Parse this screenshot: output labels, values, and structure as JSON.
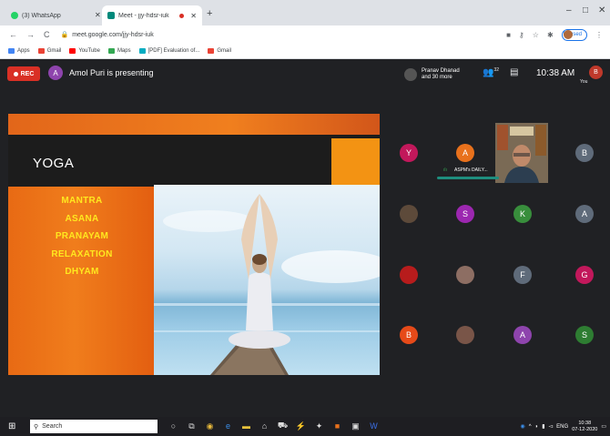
{
  "browser": {
    "tabs": [
      {
        "label": "(3) WhatsApp",
        "icon": "whatsapp-icon",
        "color": "#25d366"
      },
      {
        "label": "Meet - jjy-hdsr-iuk",
        "icon": "meet-icon",
        "color": "#00897b"
      }
    ],
    "new_tab": "+",
    "url": "meet.google.com/jjy-hdsr-iuk",
    "profile_label": "Paused",
    "bookmarks": [
      {
        "label": "Apps",
        "color": "#4285f4"
      },
      {
        "label": "Gmail",
        "color": "#ea4335"
      },
      {
        "label": "YouTube",
        "color": "#ff0000"
      },
      {
        "label": "Maps",
        "color": "#34a853"
      },
      {
        "label": "[PDF] Evaluation of...",
        "color": "#00acc1"
      },
      {
        "label": "Gmail",
        "color": "#ea4335"
      }
    ]
  },
  "meet": {
    "rec_label": "REC",
    "presenter_initial": "A",
    "presenter_text": "Amol Puri is presenting",
    "participants_summary_line1": "Pranav Dhanad",
    "participants_summary_line2": "and 30 more",
    "participants_count": "32",
    "clock": "10:38 AM",
    "you_initial": "B",
    "you_label": "You",
    "active_video_label": "ASPM's DAILY...",
    "slide": {
      "title": "YOGA",
      "items": [
        "MANTRA",
        "ASANA",
        "PRANAYAM",
        "RELAXATION",
        "DHYAM"
      ]
    },
    "participants": [
      {
        "initial": "Y",
        "color": "#c2185b"
      },
      {
        "initial": "A",
        "color": "#e8711c"
      },
      {
        "initial": "B",
        "color": "#5f6b7a"
      },
      {
        "initial": "",
        "color": "#5d4a3a",
        "photo": true
      },
      {
        "initial": "S",
        "color": "#9c27b0"
      },
      {
        "initial": "K",
        "color": "#388e3c"
      },
      {
        "initial": "A",
        "color": "#5f6b7a"
      },
      {
        "initial": "",
        "color": "#b71c1c",
        "photo": true
      },
      {
        "initial": "",
        "color": "#8d6e63",
        "photo": true
      },
      {
        "initial": "F",
        "color": "#5f6b7a"
      },
      {
        "initial": "G",
        "color": "#c2185b"
      },
      {
        "initial": "B",
        "color": "#e64a19"
      },
      {
        "initial": "",
        "color": "#795548",
        "photo": true
      },
      {
        "initial": "A",
        "color": "#8e44ad"
      },
      {
        "initial": "S",
        "color": "#2e7d32"
      }
    ]
  },
  "taskbar": {
    "search_placeholder": "Search",
    "time": "10:38",
    "date": "07-12-2020",
    "lang": "ENG"
  }
}
